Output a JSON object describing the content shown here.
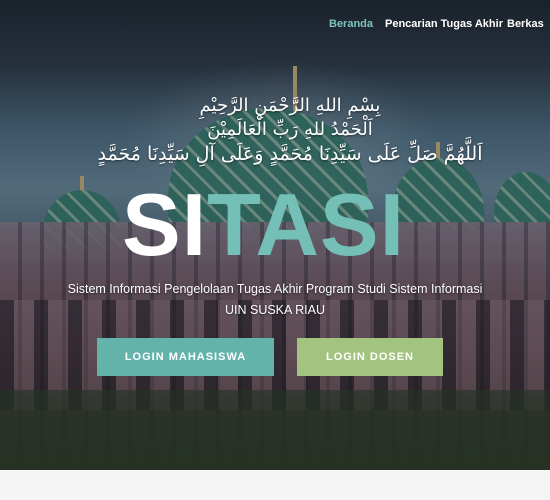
{
  "nav": {
    "items": [
      {
        "label": "Beranda",
        "active": true
      },
      {
        "label": "Pencarian Tugas Akhir",
        "active": false
      },
      {
        "label": "Berkas",
        "active": false
      }
    ]
  },
  "hero": {
    "arabic_line1": "بِسْمِ اللهِ الرَّحْمَنِ الرَّحِيْمِ",
    "arabic_line2": "اَلْحَمْدُ للهِ رَبِّ الْعَالَمِيْنَ",
    "arabic_line3": "اَللَّهُمَّ صَلِّ عَلَى سَيِّدِنَا مُحَمَّدٍ وَعَلَى آلِ سَيِّدِنَا مُحَمَّدٍ",
    "brand_part1": "SI",
    "brand_part2": "TASI",
    "subtitle_line1": "Sistem Informasi Pengelolaan Tugas Akhir Program Studi Sistem Informasi",
    "subtitle_line2": "UIN SUSKA RIAU"
  },
  "buttons": {
    "mahasiswa": "LOGIN MAHASISWA",
    "dosen": "LOGIN DOSEN"
  },
  "colors": {
    "accent_teal": "#74c0b6",
    "button_teal": "#63b3ab",
    "button_green": "#a2c47f"
  }
}
